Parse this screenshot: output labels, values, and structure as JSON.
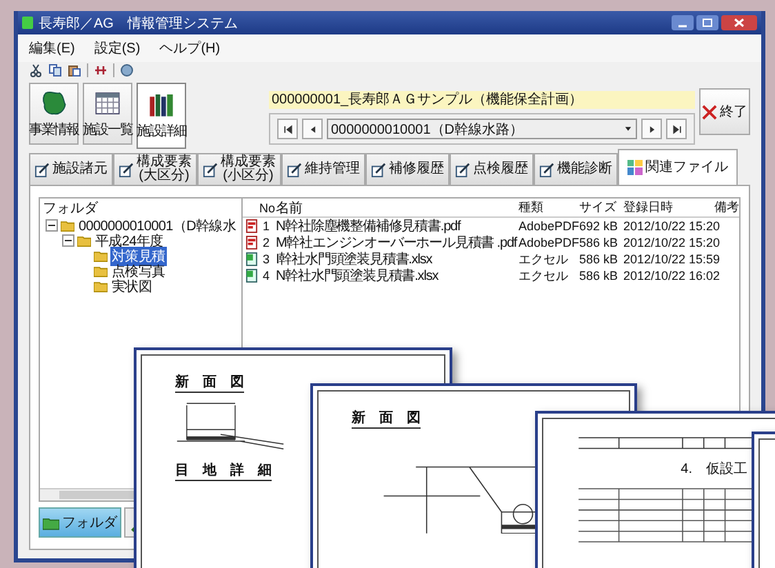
{
  "window": {
    "title": "長寿郎／AG　情報管理システム"
  },
  "menu": [
    {
      "label": "編集(E)"
    },
    {
      "label": "設定(S)"
    },
    {
      "label": "ヘルプ(H)"
    }
  ],
  "nav_buttons": [
    {
      "label": "事業情報",
      "kind": "map",
      "selected": false
    },
    {
      "label": "施設一覧",
      "kind": "grid",
      "selected": false
    },
    {
      "label": "施設詳細",
      "kind": "books",
      "selected": true
    }
  ],
  "project_title": "000000001_長寿郎ＡＧサンプル（機能保全計画）",
  "facility_select": {
    "value": "0000000010001（D幹線水路）"
  },
  "exit_button": "終了",
  "tabs": [
    {
      "label": "施設諸元",
      "selected": false
    },
    {
      "label": "構成要素",
      "sublabel": "(大区分)",
      "selected": false
    },
    {
      "label": "構成要素",
      "sublabel": "(小区分)",
      "selected": false
    },
    {
      "label": "維持管理",
      "selected": false
    },
    {
      "label": "補修履歴",
      "selected": false
    },
    {
      "label": "点検履歴",
      "selected": false
    },
    {
      "label": "機能診断",
      "selected": false
    },
    {
      "label": "関連ファイル",
      "selected": true
    }
  ],
  "folder_tree": {
    "title": "フォルダ",
    "items": [
      {
        "label": "0000000010001（D幹線水",
        "expanded": true,
        "selected": false,
        "children": [
          {
            "label": "平成24年度",
            "expanded": true,
            "selected": false,
            "children": [
              {
                "label": "対策見積",
                "selected": true
              },
              {
                "label": "点検写真",
                "selected": false
              },
              {
                "label": "実状図",
                "selected": false
              }
            ]
          }
        ]
      }
    ]
  },
  "folder_button": "フォルダ",
  "files": {
    "columns": [
      "No",
      "名前",
      "種類",
      "サイズ",
      "登録日時",
      "備考"
    ],
    "rows": [
      {
        "kind": "pdf",
        "no": "1",
        "name": "N幹社除塵機整備補修見積書.pdf",
        "type": "AdobePDF",
        "size": "692 kB",
        "date": "2012/10/22 15:20"
      },
      {
        "kind": "pdf",
        "no": "2",
        "name": "M幹社エンジンオーバーホール見積書 .pdf",
        "type": "AdobePDF",
        "size": "586 kB",
        "date": "2012/10/22 15:20"
      },
      {
        "kind": "excel",
        "no": "3",
        "name": "I幹社水門頭塗装見積書.xlsx",
        "type": "エクセル",
        "size": "586 kB",
        "date": "2012/10/22 15:59"
      },
      {
        "kind": "excel",
        "no": "4",
        "name": "N幹社水門頭塗装見積書.xlsx",
        "type": "エクセル",
        "size": "586 kB",
        "date": "2012/10/22 16:02"
      }
    ]
  },
  "documents": [
    {
      "kind": "plan",
      "headings": [
        "新　面　図",
        "目　地　詳　細"
      ]
    },
    {
      "kind": "section",
      "headings": [
        "新　面　図"
      ]
    },
    {
      "kind": "estimate",
      "headings": [
        "4.　仮設工"
      ]
    },
    {
      "kind": "page"
    }
  ]
}
